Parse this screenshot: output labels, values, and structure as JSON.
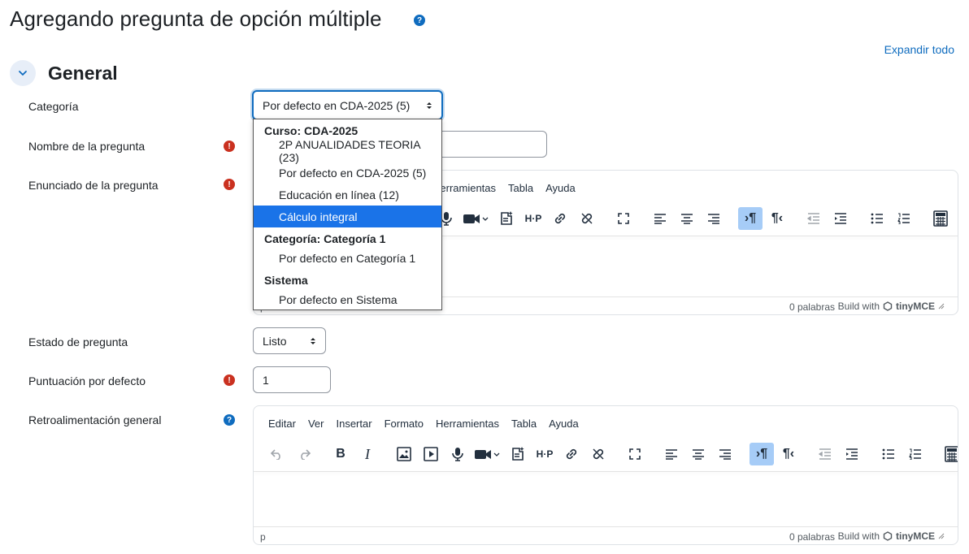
{
  "header": {
    "title": "Agregando pregunta de opción múltiple",
    "help": "?",
    "expand_all": "Expandir todo"
  },
  "section": {
    "title": "General"
  },
  "fields": {
    "category": {
      "label": "Categoría",
      "value": "Por defecto en CDA-2025 (5)"
    },
    "question_name": {
      "label": "Nombre de la pregunta"
    },
    "question_text": {
      "label": "Enunciado de la pregunta"
    },
    "status": {
      "label": "Estado de pregunta",
      "value": "Listo"
    },
    "default_mark": {
      "label": "Puntuación por defecto",
      "value": "1"
    },
    "general_feedback": {
      "label": "Retroalimentación general"
    }
  },
  "marks": {
    "required": "!",
    "help": "?"
  },
  "dropdown": {
    "groups": [
      {
        "label": "Curso: CDA-2025"
      },
      {
        "label": "Categoría: Categoría 1"
      },
      {
        "label": "Sistema"
      }
    ],
    "options": [
      {
        "label": "2P ANUALIDADES TEORIA (23)"
      },
      {
        "label": "Por defecto en CDA-2025 (5)"
      },
      {
        "label": "Educación en línea (12)"
      },
      {
        "label": "Cálculo integral",
        "selected": true
      },
      {
        "label": "Por defecto en Categoría 1"
      },
      {
        "label": "Por defecto en Sistema"
      }
    ]
  },
  "editor": {
    "menu_top_partial": "Herramientas",
    "menu": [
      "Editar",
      "Ver",
      "Insertar",
      "Formato",
      "Herramientas",
      "Tabla",
      "Ayuda"
    ],
    "menu_visible_top": [
      "Tabla",
      "Ayuda"
    ],
    "path": "p",
    "word_count": "0 palabras",
    "build_with": "Build with",
    "brand": "tinyMCE",
    "toolbar_glyphs": {
      "bold": "B",
      "italic": "I"
    }
  },
  "colors": {
    "accent": "#0f6cbf",
    "required": "#ca3120",
    "selected_option": "#1a73e8"
  }
}
